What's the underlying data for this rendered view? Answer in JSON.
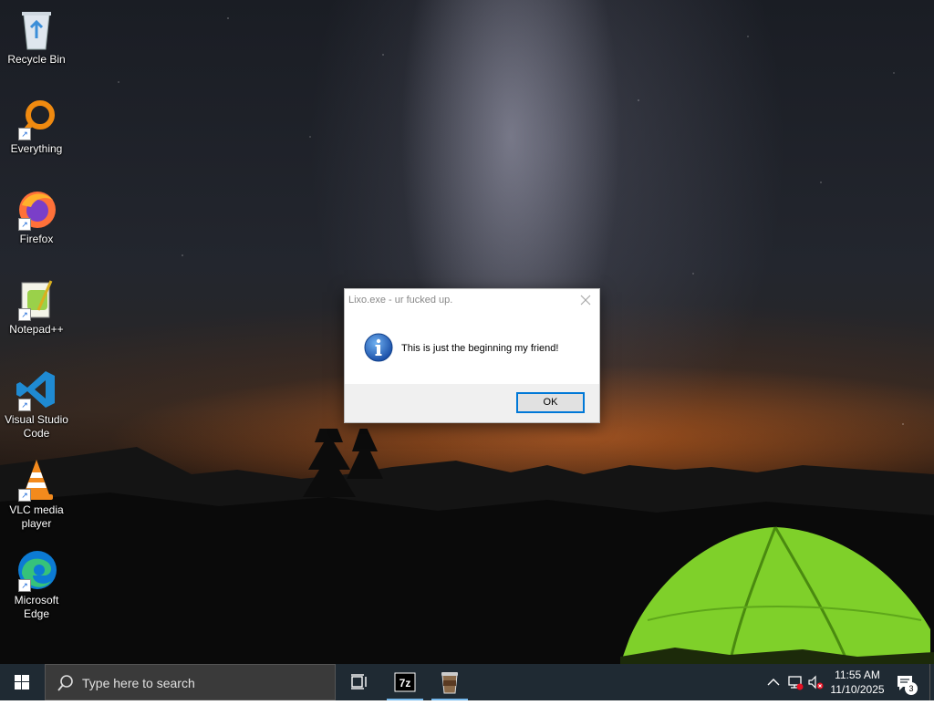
{
  "desktop": {
    "icons": [
      {
        "label": "Recycle Bin",
        "icon": "recycle-bin-icon"
      },
      {
        "label": "Everything",
        "icon": "everything-search-icon"
      },
      {
        "label": "Firefox",
        "icon": "firefox-icon"
      },
      {
        "label": "Notepad++",
        "icon": "notepad-plus-plus-icon"
      },
      {
        "label": "Visual Studio Code",
        "icon": "vscode-icon"
      },
      {
        "label": "VLC media player",
        "icon": "vlc-icon"
      },
      {
        "label": "Microsoft Edge",
        "icon": "edge-icon"
      }
    ]
  },
  "dialog": {
    "title": "Lixo.exe - ur fucked up.",
    "message": "This is just the beginning my friend!",
    "ok_label": "OK",
    "icon": "info-icon"
  },
  "taskbar": {
    "search_placeholder": "Type here to search",
    "pinned": [
      {
        "name": "task-view",
        "icon": "task-view-icon"
      },
      {
        "name": "7-zip",
        "icon": "7zip-icon",
        "label": "7z"
      },
      {
        "name": "coffee-cup-app",
        "icon": "coffee-cup-icon"
      }
    ],
    "tray": {
      "time": "11:55 AM",
      "date": "11/10/2025",
      "notification_count": "3"
    }
  },
  "colors": {
    "accent": "#0078d7",
    "taskbar_bg": "#1f2a33",
    "dialog_footer": "#f0f0f0"
  }
}
